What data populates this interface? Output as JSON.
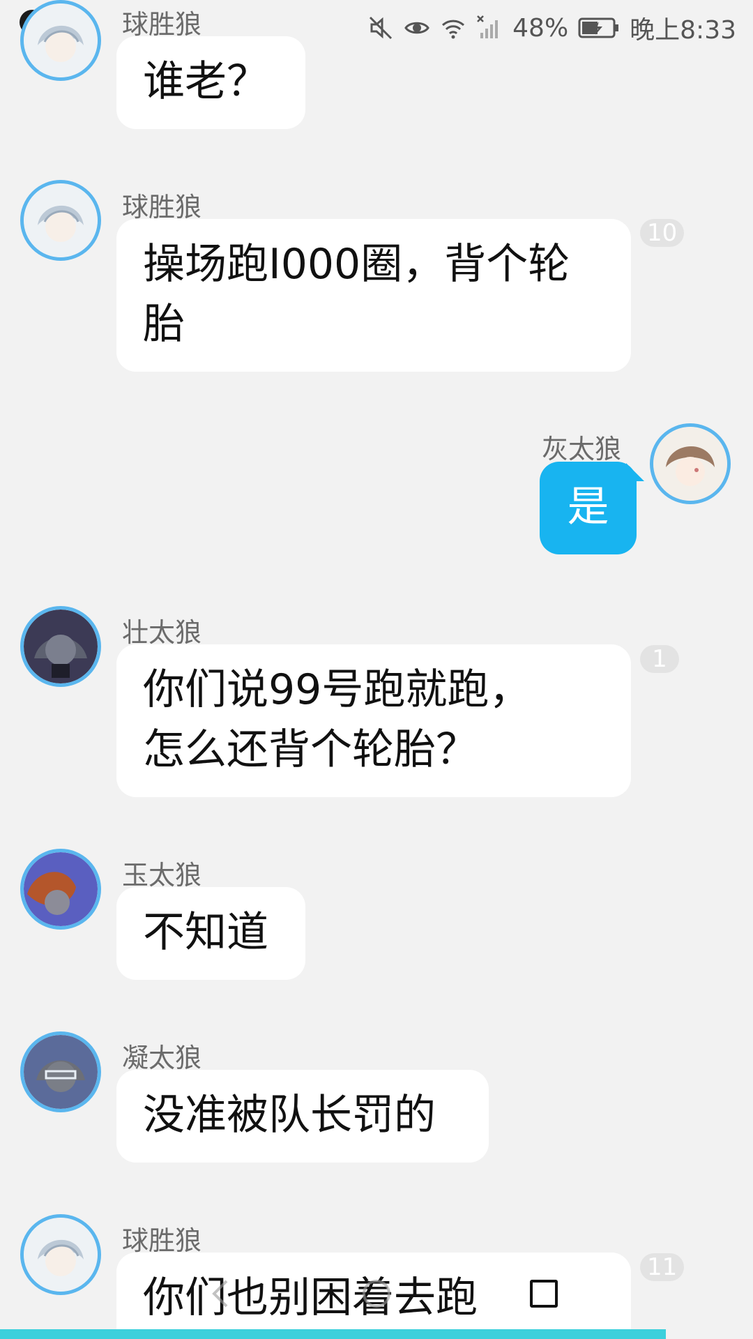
{
  "status_bar": {
    "battery_percent": "48%",
    "time": "晚上8:33",
    "icons": [
      "tiktok-icon",
      "music-icon",
      "mute-icon",
      "eye-icon",
      "wifi-icon",
      "no-signal-icon",
      "battery-charging-icon"
    ]
  },
  "messages": [
    {
      "sender": "球胜狼",
      "text": "谁老？",
      "avatar": "avatar-white-hair-boy",
      "badge": ""
    },
    {
      "sender": "球胜狼",
      "line1": "操场跑I000圈，背个轮",
      "line2": "胎",
      "avatar": "avatar-white-hair-boy",
      "badge": "10"
    },
    {
      "sender": "灰太狼",
      "text": "是",
      "avatar": "avatar-brown-hair-boy",
      "self": true
    },
    {
      "sender": "壮太狼",
      "line1": "你们说99号跑就跑，",
      "line2": "怎么还背个轮胎？",
      "avatar": "avatar-grey-wolf",
      "badge": "1"
    },
    {
      "sender": "玉太狼",
      "text": "不知道",
      "avatar": "avatar-red-hair-wolf",
      "badge": ""
    },
    {
      "sender": "凝太狼",
      "text": "没准被队长罚的",
      "avatar": "avatar-glasses-wolf",
      "badge": ""
    },
    {
      "sender": "球胜狼",
      "text": "你们也别困着去跑",
      "avatar": "avatar-white-hair-boy",
      "badge": "11"
    }
  ],
  "colors": {
    "self_bubble": "#18b4f0",
    "avatar_ring": "#5ab6ee",
    "background": "#f2f2f2"
  }
}
